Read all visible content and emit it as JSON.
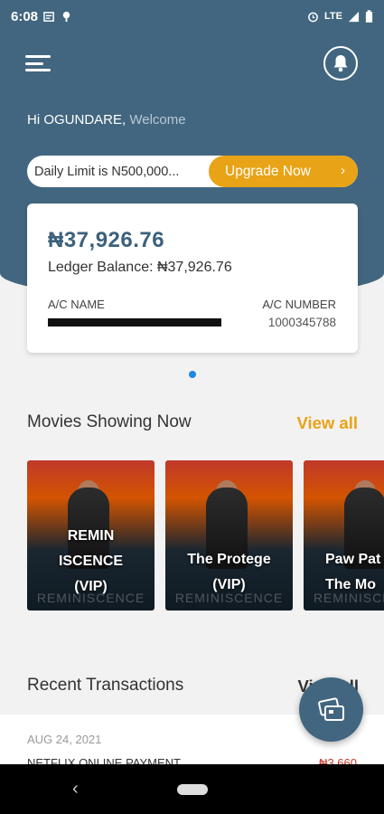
{
  "status_bar": {
    "time": "6:08",
    "network": "LTE"
  },
  "greeting": {
    "name": "Hi OGUNDARE,",
    "welcome": "Welcome"
  },
  "limit": {
    "text": "Daily Limit is N500,000...",
    "upgrade_label": "Upgrade Now",
    "chevron": "›"
  },
  "balance": {
    "amount": "₦37,926.76",
    "ledger": "Ledger Balance: ₦37,926.76",
    "ac_name_label": "A/C NAME",
    "ac_number_label": "A/C NUMBER",
    "ac_number": "1000345788"
  },
  "movies": {
    "title": "Movies Showing Now",
    "view_all": "View all",
    "items": [
      {
        "title": "REMIN\nISCENCE\n(VIP)"
      },
      {
        "title": "The Protege\n(VIP)"
      },
      {
        "title": "Paw Pat\nThe Mo"
      }
    ],
    "poster_text": "REMINISCENCE"
  },
  "transactions": {
    "title": "Recent Transactions",
    "view_all": "View all",
    "items": [
      {
        "date": "AUG 24, 2021",
        "description": "NETFLIX ONLINE PAYMENT",
        "amount": "₦3,660"
      }
    ]
  },
  "colors": {
    "primary": "#42667f",
    "accent": "#e8a316",
    "pager_dot": "#1e88e5"
  },
  "icons": {
    "menu": "menu-icon",
    "bell": "bell-icon",
    "fab": "cards-icon",
    "back": "back-icon"
  }
}
